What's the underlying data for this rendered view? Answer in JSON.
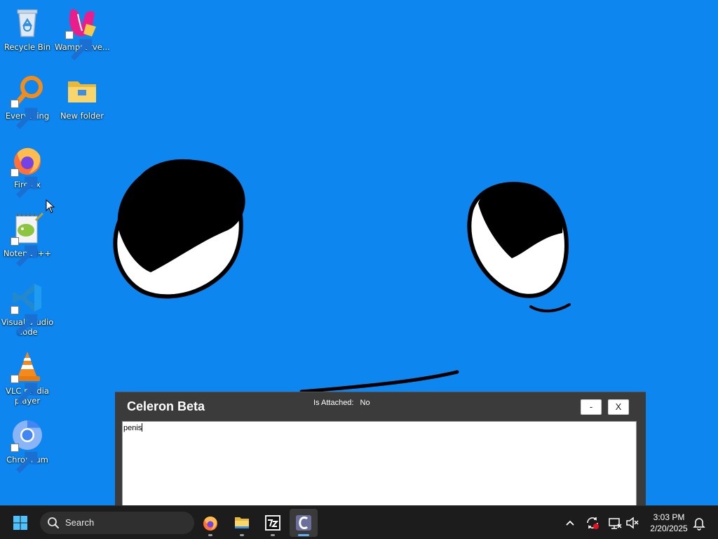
{
  "desktop": {
    "icons": [
      {
        "label": "Recycle Bin",
        "icon": "recycle-bin-icon",
        "shortcut": false
      },
      {
        "label": "Wampserve...",
        "icon": "wampserver-icon",
        "shortcut": true
      },
      {
        "label": "Everything",
        "icon": "everything-search-icon",
        "shortcut": true
      },
      {
        "label": "New folder",
        "icon": "folder-icon",
        "shortcut": false
      },
      {
        "label": "Firefox",
        "icon": "firefox-icon",
        "shortcut": true
      },
      {
        "label": "Notepad++",
        "icon": "notepad-plus-plus-icon",
        "shortcut": true
      },
      {
        "label": "Visual Studio Code",
        "icon": "vscode-icon",
        "shortcut": true
      },
      {
        "label": "VLC media player",
        "icon": "vlc-icon",
        "shortcut": true
      },
      {
        "label": "Chromium",
        "icon": "chromium-icon",
        "shortcut": true
      }
    ]
  },
  "app": {
    "title": "Celeron Beta",
    "attached_label": "Is Attached:",
    "attached_value": "No",
    "minimize_label": "-",
    "close_label": "X",
    "editor_text": "penis"
  },
  "taskbar": {
    "search_label": "Search",
    "apps": [
      "firefox-icon",
      "file-explorer-icon",
      "7zip-icon",
      "celeron-icon"
    ],
    "active_app": "celeron-icon",
    "tray": [
      "show-hidden-icons-chevron",
      "sync-icon",
      "network-icon",
      "volume-muted-icon",
      "notifications-bell-icon"
    ],
    "time": "3:03 PM",
    "date": "2/20/2025"
  },
  "colors": {
    "desktop_background": "#0d86f0",
    "window_background": "#3b3b3b",
    "taskbar_background": "#1c1c1c",
    "accent": "#5fb2f2"
  }
}
